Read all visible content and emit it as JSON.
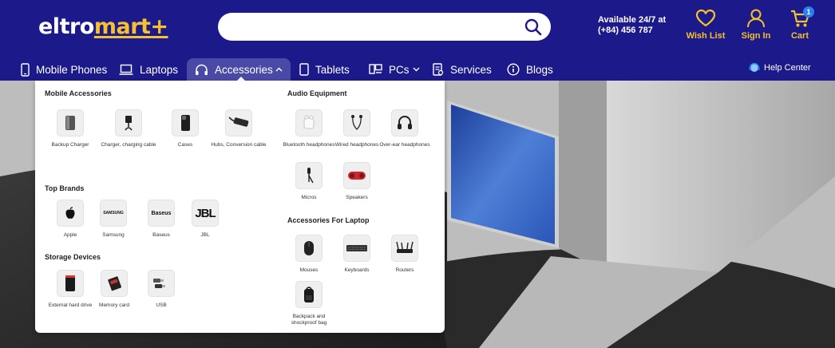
{
  "header": {
    "logo_part1": "eltro",
    "logo_part2": "mart+",
    "search_placeholder": "",
    "availability_line1": "Available 24/7 at",
    "availability_line2": "(+84) 456 787",
    "wishlist_label": "Wish List",
    "signin_label": "Sign In",
    "cart_label": "Cart",
    "cart_count": "1",
    "accent_color": "#f5c12e",
    "header_color": "#1c1a8a"
  },
  "nav": {
    "items": [
      {
        "label": "Mobile Phones",
        "icon": "phone-icon"
      },
      {
        "label": "Laptops",
        "icon": "laptop-icon"
      },
      {
        "label": "Accessories",
        "icon": "headphones-icon"
      },
      {
        "label": "Tablets",
        "icon": "tablet-icon"
      },
      {
        "label": "PCs",
        "icon": "pc-icon"
      },
      {
        "label": "Services",
        "icon": "services-icon"
      },
      {
        "label": "Blogs",
        "icon": "info-icon"
      }
    ],
    "help_label": "Help Center"
  },
  "dropdown": {
    "mobile_accessories": {
      "title": "Mobile Accessories",
      "items": [
        "Backup Charger",
        "Charger, charging cable",
        "Cases",
        "Hubs, Conversion cable"
      ]
    },
    "audio_equipment": {
      "title": "Audio Equipment",
      "items": [
        "Bluetooth headphones",
        "Wired headphones",
        "Over-ear headphones",
        "Micros",
        "Speakers"
      ]
    },
    "top_brands": {
      "title": "Top Brands",
      "items": [
        "Apple",
        "Samsung",
        "Baseus",
        "JBL"
      ],
      "logo_text": [
        "SAMSUNG",
        "Baseus",
        "JBL"
      ]
    },
    "accessories_laptop": {
      "title": "Accessories For Laptop",
      "items": [
        "Mouses",
        "Keyboards",
        "Routers",
        "Backpack and shockproof bag"
      ]
    },
    "storage_devices": {
      "title": "Storage Devices",
      "items": [
        "External hard drive",
        "Memory card",
        "USB"
      ]
    }
  }
}
